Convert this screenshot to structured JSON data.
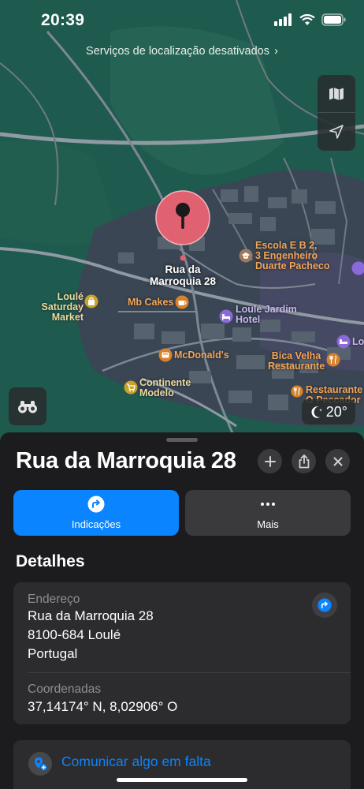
{
  "status_bar": {
    "time": "20:39"
  },
  "banner": {
    "text": "Serviços de localização desativados",
    "chevron": "›"
  },
  "map": {
    "pin_label": "Rua da Marroquia 28",
    "pois": [
      {
        "name": "Escola E B 2,\n3 Engenheiro\nDuarte Pacheco",
        "icon": "school-icon"
      },
      {
        "name": "Loulé Saturday\nMarket",
        "icon": "shopping-icon"
      },
      {
        "name": "Mb Cakes",
        "icon": "cafe-icon"
      },
      {
        "name": "Loulé Jardim\nHotel",
        "icon": "hotel-icon"
      },
      {
        "name": "McDonald's",
        "icon": "fast-food-icon"
      },
      {
        "name": "Bica Velha\nRestaurante",
        "icon": "restaurant-icon"
      },
      {
        "name": "Continente\nModelo",
        "icon": "shopping-icon"
      },
      {
        "name": "Restaurante\nO Peccador",
        "icon": "restaurant-icon"
      },
      {
        "name": "Lo",
        "icon": "hotel-icon"
      }
    ],
    "weather": {
      "temp": "20°",
      "icon": "moon-icon"
    }
  },
  "sheet": {
    "title": "Rua da Marroquia 28",
    "actions": [
      {
        "label": "Indicações",
        "icon": "directions-icon"
      },
      {
        "label": "Mais",
        "icon": "more-icon"
      }
    ],
    "details_title": "Detalhes",
    "address": {
      "label": "Endereço",
      "line1": "Rua da Marroquia 28",
      "line2": "8100-684 Loulé",
      "line3": "Portugal"
    },
    "coordinates": {
      "label": "Coordenadas",
      "value": "37,14174° N, 8,02906° O"
    },
    "report_link": "Comunicar algo em falta"
  },
  "colors": {
    "accent": "#0a84ff",
    "pin": "#e0616f",
    "map_green": "#1f5a4f"
  }
}
